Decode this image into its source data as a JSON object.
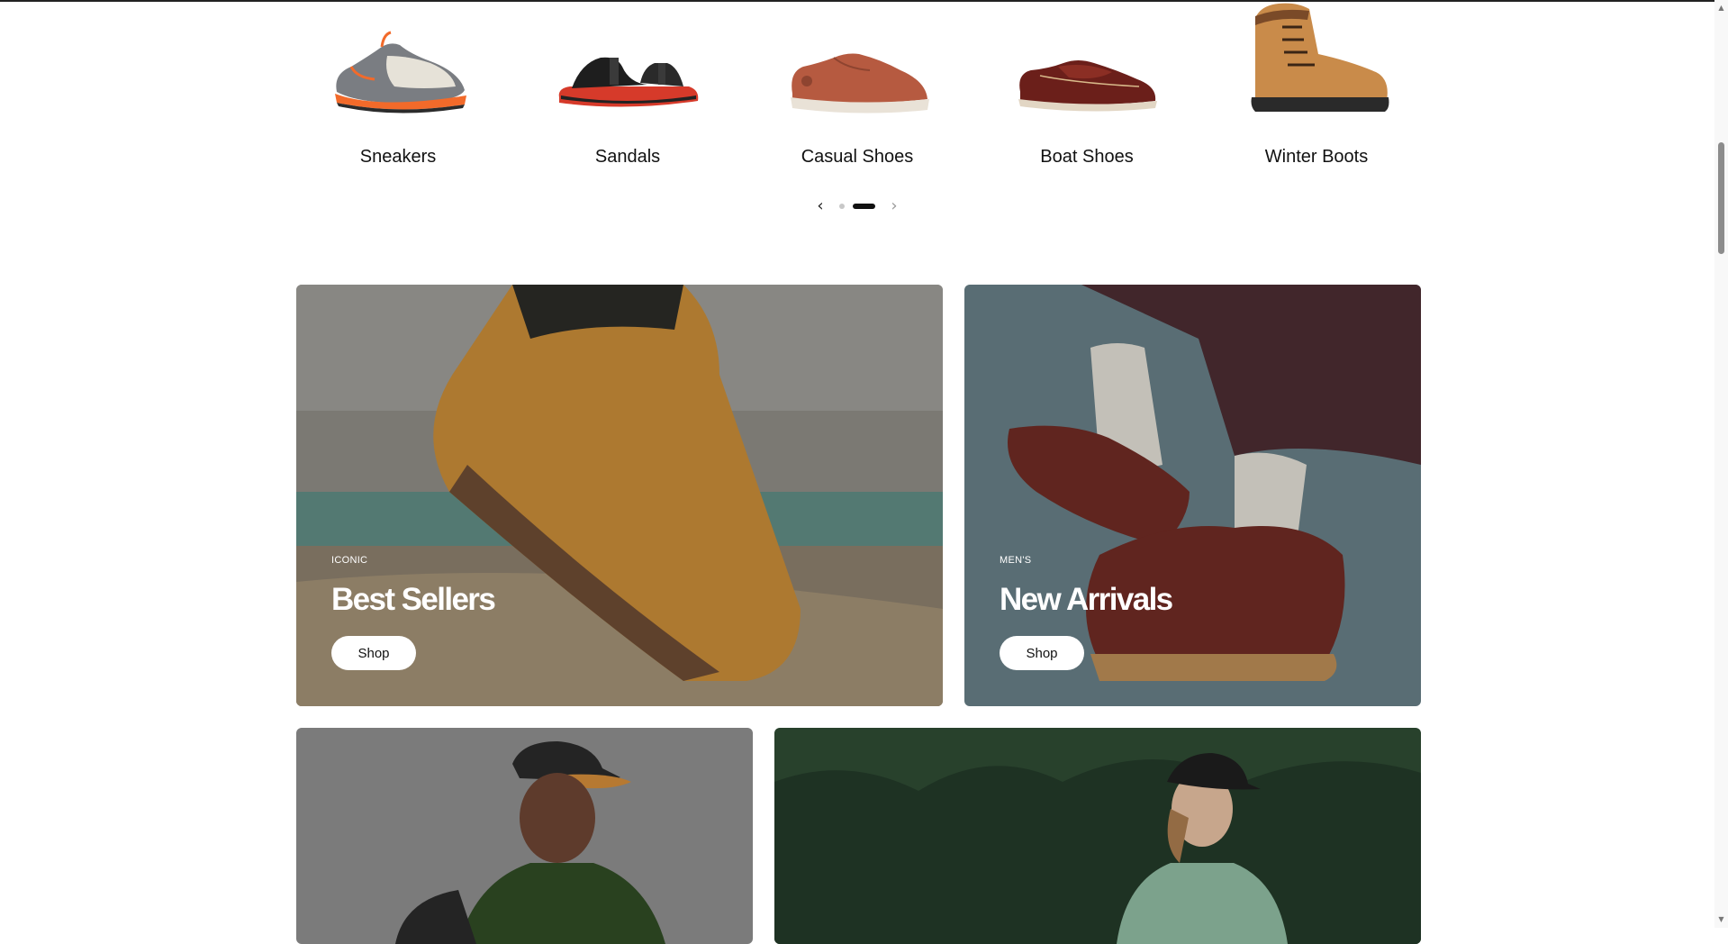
{
  "categories": {
    "items": [
      {
        "label": "Sneakers"
      },
      {
        "label": "Sandals"
      },
      {
        "label": "Casual Shoes"
      },
      {
        "label": "Boat Shoes"
      },
      {
        "label": "Winter Boots"
      }
    ],
    "carousel": {
      "active_page": 2,
      "page_count": 2
    }
  },
  "promos": [
    {
      "eyebrow": "ICONIC",
      "title": "Best Sellers",
      "button_label": "Shop"
    },
    {
      "eyebrow": "MEN'S",
      "title": "New Arrivals",
      "button_label": "Shop"
    }
  ],
  "colors": {
    "text": "#111111",
    "button_bg": "#ffffff",
    "dot_active": "#111111",
    "dot_inactive": "#c8c8c8"
  },
  "icons": {
    "prev": "chevron-left-icon",
    "next": "chevron-right-icon",
    "scroll_up": "triangle-up-icon",
    "scroll_down": "triangle-down-icon"
  }
}
